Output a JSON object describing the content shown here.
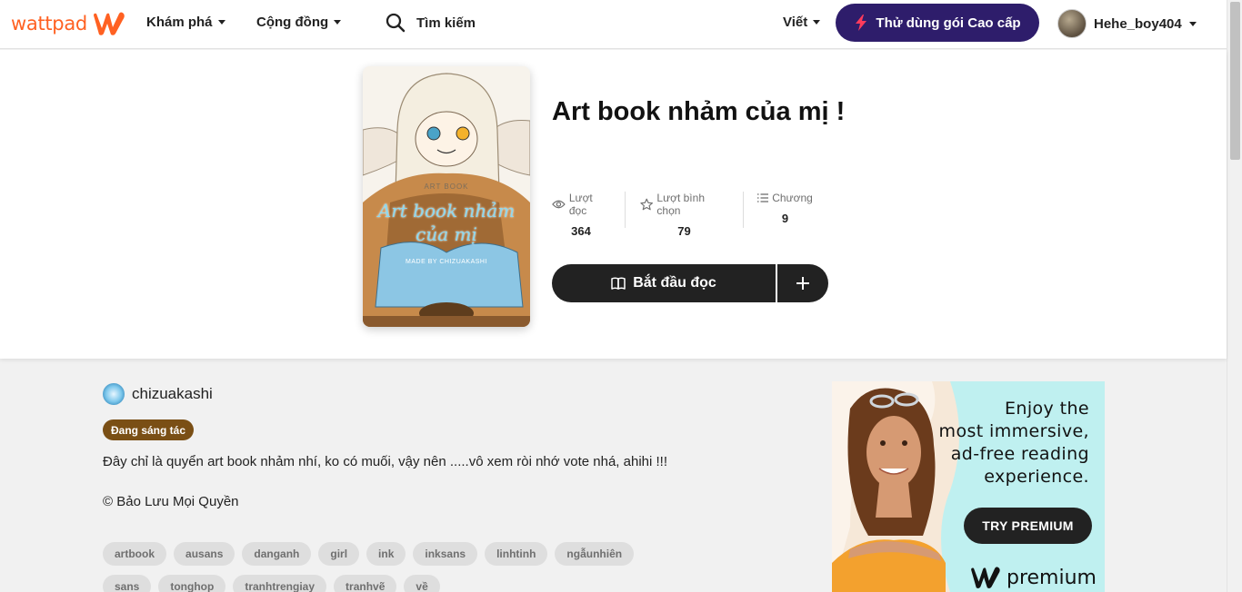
{
  "brand": {
    "name": "wattpad",
    "color": "#ff6122"
  },
  "nav": {
    "explore": "Khám phá",
    "community": "Cộng đồng",
    "search_placeholder": "Tìm kiếm",
    "write": "Viết",
    "premium": "Thử dùng gói Cao cấp",
    "username": "Hehe_boy404"
  },
  "story": {
    "cover": {
      "label": "ART BOOK",
      "title_line1": "Art book nhảm",
      "title_line2": "của mị",
      "byline": "MADE BY CHIZUAKASHI"
    },
    "title": "Art book nhảm của mị !",
    "stats": [
      {
        "icon": "eye-icon",
        "label": "Lượt đọc",
        "value": "364"
      },
      {
        "icon": "star-icon",
        "label": "Lượt bình chọn",
        "value": "79"
      },
      {
        "icon": "list-icon",
        "label": "Chương",
        "value": "9"
      }
    ],
    "read_button": "Bắt đầu đọc",
    "author": "chizuakashi",
    "status": "Đang sáng tác",
    "description": "Đây chỉ là quyển art book nhảm nhí, ko có muối, vậy nên .....vô xem ròi nhớ vote nhá, ahihi !!!",
    "copyright": "© Bảo Lưu Mọi Quyền",
    "tags": [
      "artbook",
      "ausans",
      "danganh",
      "girl",
      "ink",
      "inksans",
      "linhtinh",
      "ngẫunhiên",
      "sans",
      "tonghop",
      "tranhtrengiay",
      "tranhvẽ",
      "về"
    ]
  },
  "ad": {
    "line1": "Enjoy the",
    "line2": "most immersive,",
    "line3": "ad-free reading",
    "line4": "experience.",
    "button": "TRY PREMIUM",
    "brand": "premium"
  },
  "colors": {
    "premium_bg": "#2e1d6b",
    "status_badge": "#7a4f15",
    "ad_bg": "#bff0f0"
  }
}
